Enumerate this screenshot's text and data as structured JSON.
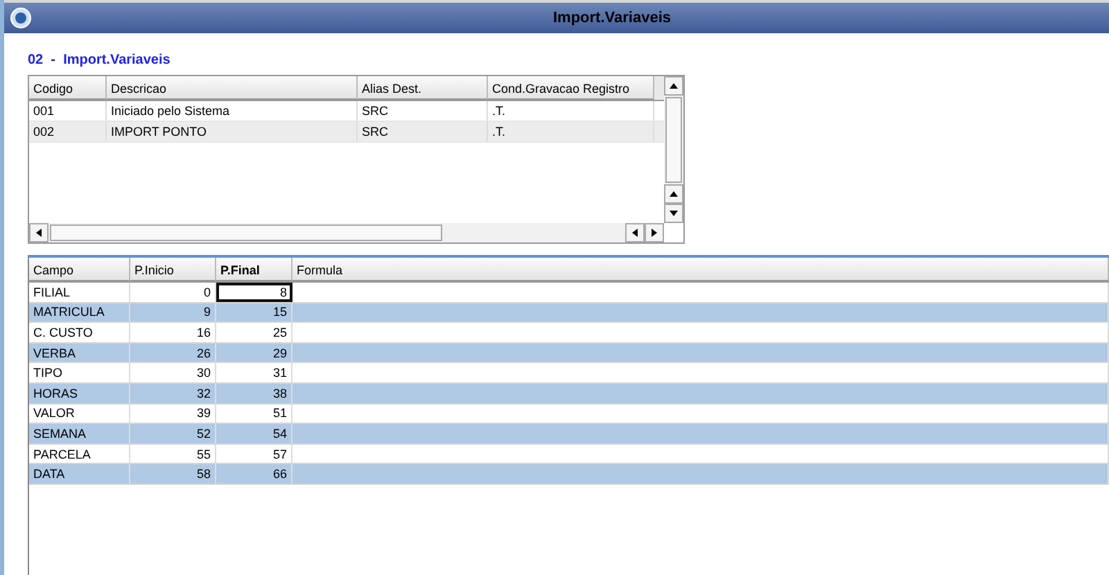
{
  "window": {
    "title": "Import.Variaveis"
  },
  "heading": "02  -  Import.Variaveis",
  "top_table": {
    "columns": [
      "Codigo",
      "Descricao",
      "Alias Dest.",
      "Cond.Gravacao Registro"
    ],
    "rows": [
      {
        "cells": [
          "001",
          "Iniciado pelo Sistema",
          "SRC",
          ".T."
        ],
        "selected": false
      },
      {
        "cells": [
          "002",
          "IMPORT PONTO",
          "SRC",
          ".T."
        ],
        "selected": true
      }
    ]
  },
  "bottom_table": {
    "columns": [
      {
        "label": "Campo",
        "selected": false
      },
      {
        "label": "P.Inicio",
        "selected": false
      },
      {
        "label": "P.Final",
        "selected": true
      },
      {
        "label": "Formula",
        "selected": false
      }
    ],
    "rows": [
      {
        "cells": [
          "FILIAL",
          "0",
          "8",
          ""
        ],
        "focused": true
      },
      {
        "cells": [
          "MATRICULA",
          "9",
          "15",
          ""
        ],
        "focused": false
      },
      {
        "cells": [
          "C. CUSTO",
          "16",
          "25",
          ""
        ],
        "focused": false
      },
      {
        "cells": [
          "VERBA",
          "26",
          "29",
          ""
        ],
        "focused": false
      },
      {
        "cells": [
          "TIPO",
          "30",
          "31",
          ""
        ],
        "focused": false
      },
      {
        "cells": [
          "HORAS",
          "32",
          "38",
          ""
        ],
        "focused": false
      },
      {
        "cells": [
          "VALOR",
          "39",
          "51",
          ""
        ],
        "focused": false
      },
      {
        "cells": [
          "SEMANA",
          "52",
          "54",
          ""
        ],
        "focused": false
      },
      {
        "cells": [
          "PARCELA",
          "55",
          "57",
          ""
        ],
        "focused": false
      },
      {
        "cells": [
          "DATA",
          "58",
          "66",
          ""
        ],
        "focused": false
      }
    ]
  }
}
